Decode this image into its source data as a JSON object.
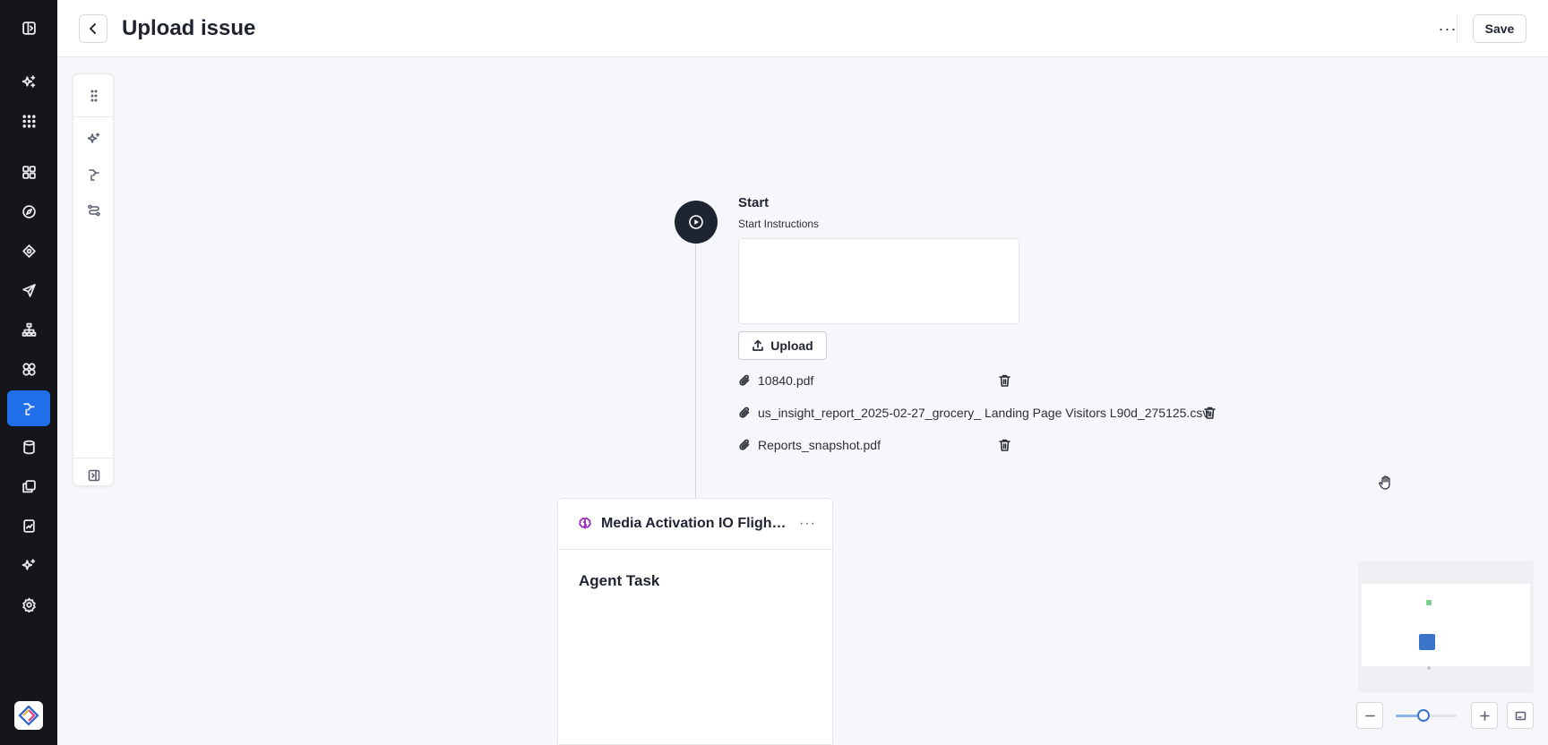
{
  "header": {
    "title": "Upload issue",
    "more_label": "···",
    "save_label": "Save"
  },
  "rail": {
    "items": [
      {
        "icon": "panel-toggle-icon"
      },
      {
        "icon": "sparkles-icon"
      },
      {
        "icon": "apps-grid-icon"
      },
      {
        "icon": "dashboard-icon"
      },
      {
        "icon": "compass-icon"
      },
      {
        "icon": "target-icon"
      },
      {
        "icon": "send-icon"
      },
      {
        "icon": "hierarchy-icon"
      },
      {
        "icon": "circles-icon"
      },
      {
        "icon": "workflow-icon",
        "active": true
      },
      {
        "icon": "database-icon"
      },
      {
        "icon": "copy-icon"
      },
      {
        "icon": "report-icon"
      },
      {
        "icon": "sparkles-icon"
      },
      {
        "icon": "settings-icon"
      }
    ]
  },
  "palette": {
    "items": [
      "drag-handle-icon",
      "ai-sparkle-icon",
      "workflow-icon",
      "route-icon",
      "collapse-panel-icon"
    ]
  },
  "start_node": {
    "title": "Start",
    "subtitle": "Start Instructions",
    "instructions_value": "",
    "upload_label": "Upload",
    "files": [
      {
        "name": "10840.pdf"
      },
      {
        "name": "us_insight_report_2025-02-27_grocery_ Landing Page Visitors L90d_275125.csv"
      },
      {
        "name": "Reports_snapshot.pdf"
      }
    ]
  },
  "agent_card": {
    "name": "Media Activation IO Flight ...",
    "more_label": "···",
    "task_label": "Agent Task"
  },
  "zoom": {
    "level": 0.45
  },
  "colors": {
    "rail_bg": "#14161c",
    "accent": "#1f6feb",
    "agent_icon": "#9b2db8",
    "minimap_block": "#3a74c9"
  }
}
